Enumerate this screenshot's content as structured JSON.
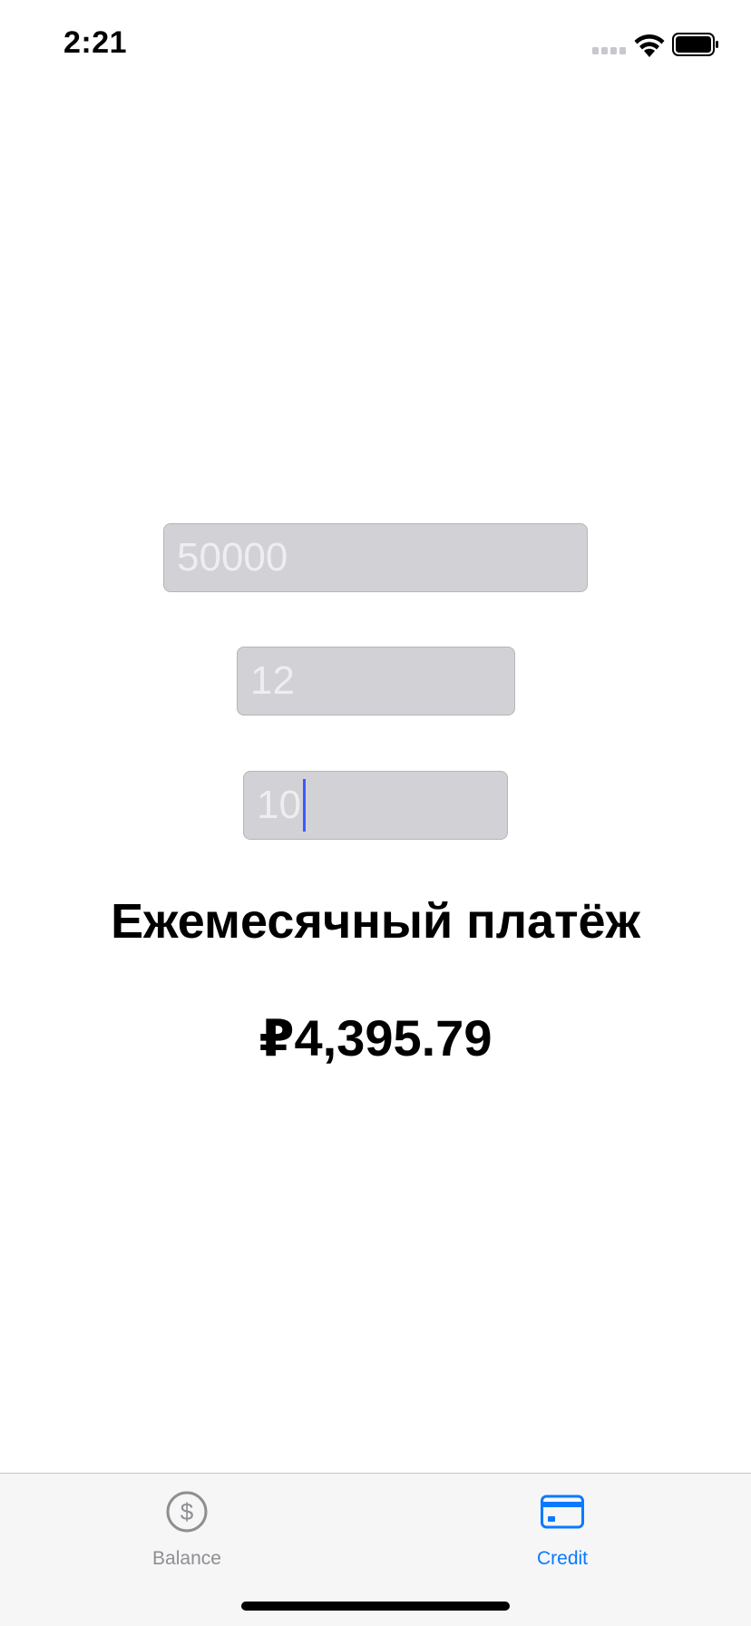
{
  "status_bar": {
    "time": "2:21"
  },
  "form": {
    "amount_value": "50000",
    "months_value": "12",
    "rate_value": "10"
  },
  "result": {
    "title": "Ежемесячный платёж",
    "value": "₽4,395.79"
  },
  "tab_bar": {
    "items": [
      {
        "label": "Balance",
        "icon": "dollar-circle-icon",
        "selected": false
      },
      {
        "label": "Credit",
        "icon": "credit-card-icon",
        "selected": true
      }
    ]
  },
  "colors": {
    "accent": "#0a7aff",
    "inactive_tab": "#8e8e93",
    "field_background": "#d1d1d6",
    "cursor": "#3d5afe"
  }
}
